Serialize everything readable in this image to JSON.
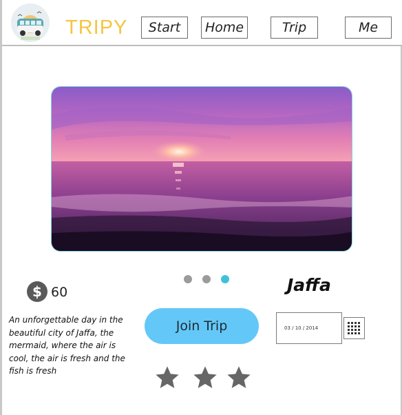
{
  "app": {
    "brand": "TRIPY",
    "logo_icon": "camper-van-icon",
    "brand_color": "#f5c542"
  },
  "nav": {
    "items": [
      {
        "label": "Start"
      },
      {
        "label": "Home"
      },
      {
        "label": "Trip"
      },
      {
        "label": "Me"
      }
    ]
  },
  "hero": {
    "image_icon": "sunset-sea-image",
    "carousel": {
      "count": 3,
      "active_index": 2
    }
  },
  "trip": {
    "name": "Jaffa",
    "price_symbol": "$",
    "price": "60",
    "description": "An unforgettable day in the beautiful city of Jaffa, the mermaid, where the air is cool, the air is fresh and the fish is fresh",
    "join_label": "Join Trip",
    "join_color": "#63c8f7",
    "date": "03 / 10 / 2014",
    "rating": 3
  }
}
